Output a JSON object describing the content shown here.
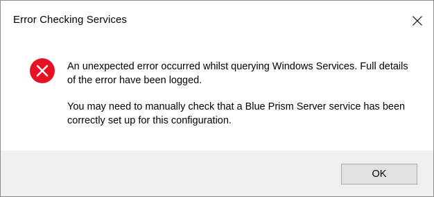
{
  "window": {
    "title": "Error Checking Services",
    "close_icon": "close-icon"
  },
  "message": {
    "icon": "error-icon",
    "paragraph_1": "An unexpected error occurred whilst querying Windows Services. Full details of the error have been logged.",
    "paragraph_2": "You may need to manually check that a Blue Prism Server service has been correctly set up for this configuration."
  },
  "buttons": {
    "ok_label": "OK"
  },
  "colors": {
    "error_red": "#e81123",
    "footer_bg": "#f0f0f0",
    "button_bg": "#e1e1e1",
    "button_border": "#adadad"
  }
}
